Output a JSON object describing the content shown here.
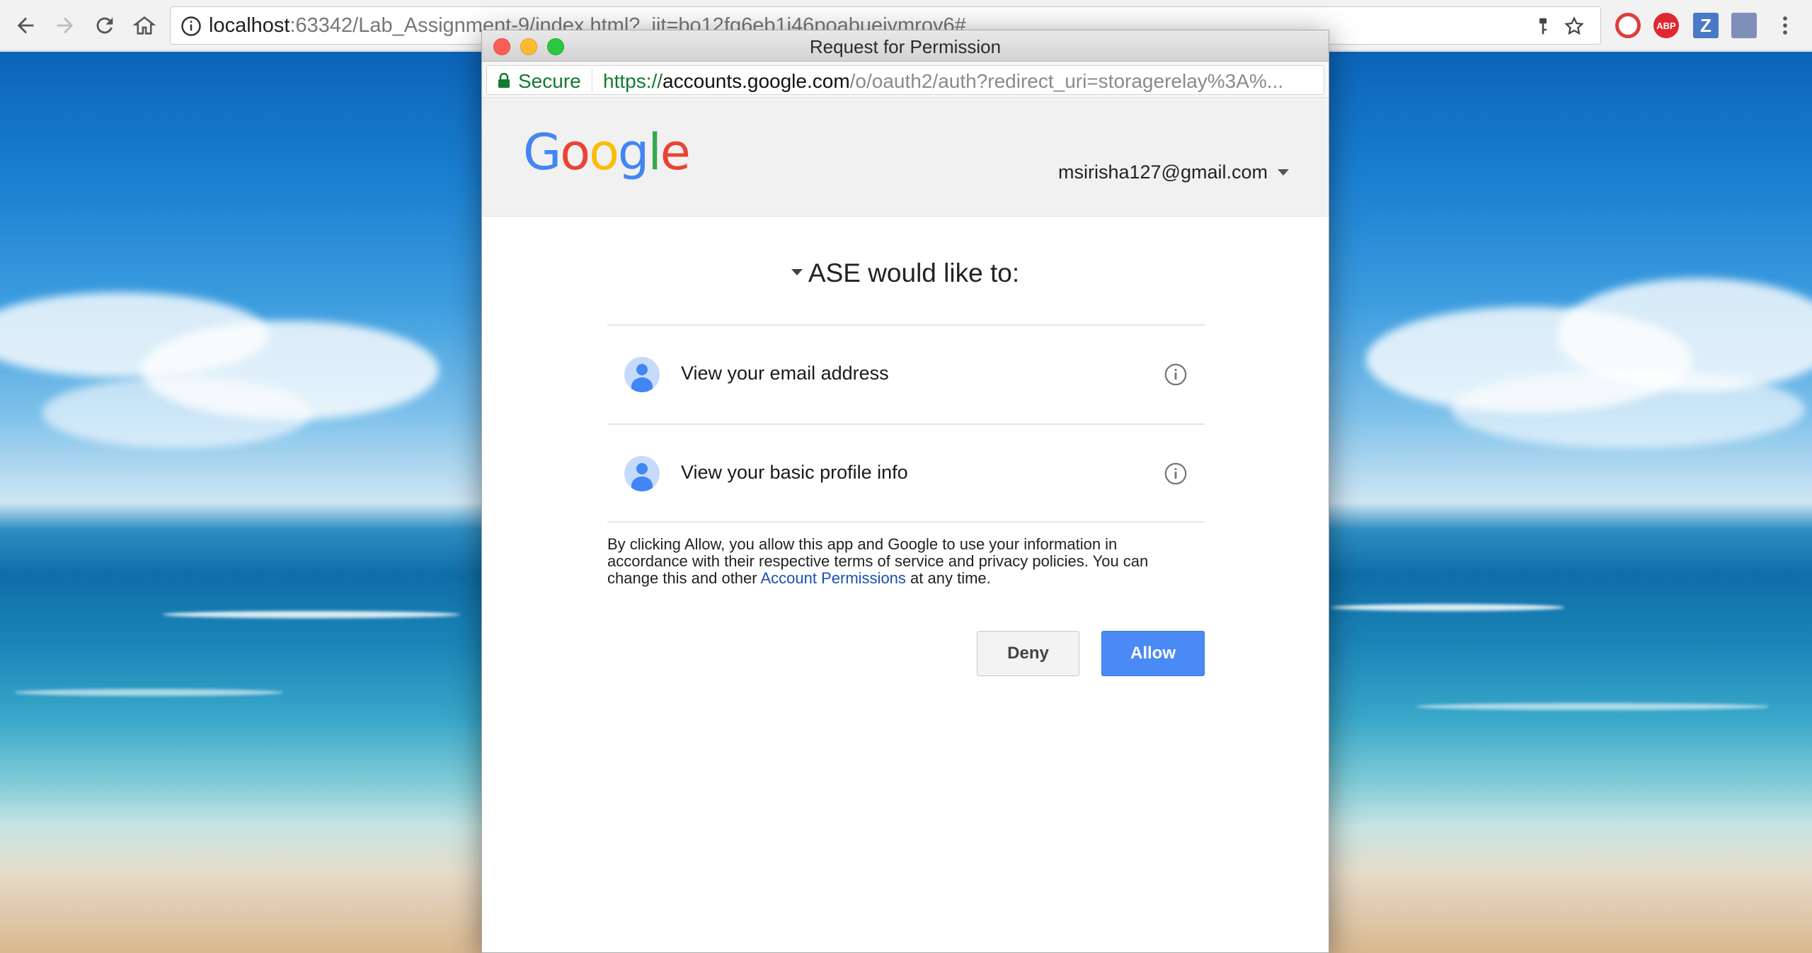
{
  "browser": {
    "url_host": "localhost",
    "url_rest": ":63342/Lab_Assignment-9/index.html?_ijt=bo12fg6eb1j46poabueiymrov6#",
    "extensions": [
      "opera-icon",
      "abp-icon",
      "z-icon",
      "photo-icon"
    ],
    "ext_labels": {
      "abp": "ABP",
      "z": "Z"
    }
  },
  "popup": {
    "title": "Request for Permission",
    "secure_label": "Secure",
    "url_scheme": "https://",
    "url_host": "accounts.google.com",
    "url_path": "/o/oauth2/auth?redirect_uri=storagerelay%3A%..."
  },
  "consent": {
    "account_email": "msirisha127@gmail.com",
    "heading": "ASE would like to:",
    "permissions": [
      {
        "label": "View your email address"
      },
      {
        "label": "View your basic profile info"
      }
    ],
    "disclaimer_pre": "By clicking Allow, you allow this app and Google to use your information in accordance with their respective terms of service and privacy policies. You can change this and other ",
    "disclaimer_link": "Account Permissions",
    "disclaimer_post": " at any time.",
    "deny_label": "Deny",
    "allow_label": "Allow"
  },
  "colors": {
    "allow_button": "#4a8af4",
    "secure_green": "#137a31",
    "link_blue": "#1a4fb4"
  }
}
